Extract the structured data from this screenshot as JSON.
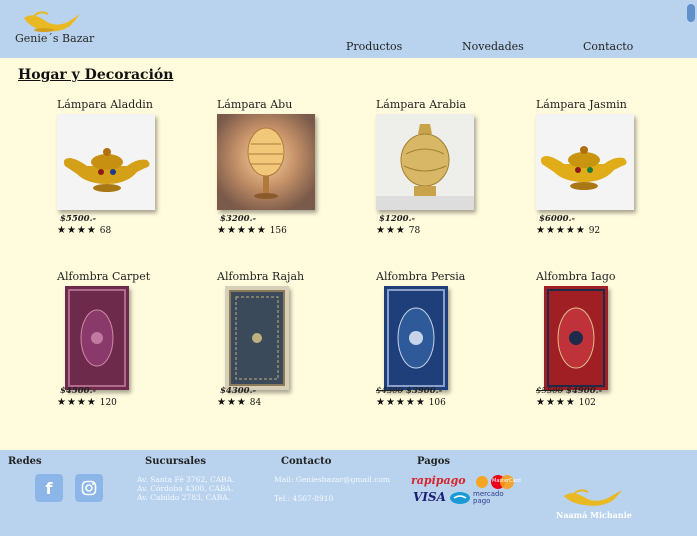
{
  "header": {
    "brand": "Genie´s Bazar",
    "nav": [
      "Productos",
      "Novedades",
      "Contacto"
    ]
  },
  "main": {
    "title": "Hogar y Decoración",
    "products": [
      {
        "name": "Lámpara Aladdin",
        "price": "$5500.-",
        "old_price": "",
        "stars": "★★★★",
        "reviews": "68",
        "kind": "lamp-gold"
      },
      {
        "name": "Lámpara Abu",
        "price": "$3200.-",
        "old_price": "",
        "stars": "★★★★★",
        "reviews": "156",
        "kind": "lamp-abu"
      },
      {
        "name": "Lámpara Arabia",
        "price": "$1200.-",
        "old_price": "",
        "stars": "★★★",
        "reviews": "78",
        "kind": "lamp-arabia"
      },
      {
        "name": "Lámpara Jasmin",
        "price": "$6000.-",
        "old_price": "",
        "stars": "★★★★★",
        "reviews": "92",
        "kind": "lamp-gold"
      },
      {
        "name": "Alfombra Carpet",
        "price": "$4500.-",
        "old_price": "",
        "stars": "★★★★",
        "reviews": "120",
        "kind": "rug-purple"
      },
      {
        "name": "Alfombra Rajah",
        "price": "$4300.-",
        "old_price": "",
        "stars": "★★★",
        "reviews": "84",
        "kind": "rug-grey"
      },
      {
        "name": "Alfombra Persia",
        "price": "$3900.-",
        "old_price": "$4300",
        "stars": "★★★★★",
        "reviews": "106",
        "kind": "rug-blue"
      },
      {
        "name": "Alfombra Iago",
        "price": "$4900.-",
        "old_price": "$5500",
        "stars": "★★★★",
        "reviews": "102",
        "kind": "rug-red"
      }
    ]
  },
  "footer": {
    "redes": "Redes",
    "sucursales": "Sucursales",
    "sucursales_lines": [
      "Av. Santa Fé 3762, CABA.",
      "Av. Córdoba 4300, CABA.",
      "Av. Cabildo 2783, CABA."
    ],
    "contacto": "Contacto",
    "mail": "Mail: Geniesbazar@gmail.com",
    "tel": "Tel.: 4567-8910",
    "pagos": "Pagos",
    "pay_methods": [
      "rapipago",
      "MasterCard",
      "VISA",
      "mercado pago"
    ],
    "signature": "Naamá Michanie"
  },
  "colors": {
    "header": "#b9d3ee",
    "background": "#fffbdc",
    "gold": "#e8b923"
  }
}
